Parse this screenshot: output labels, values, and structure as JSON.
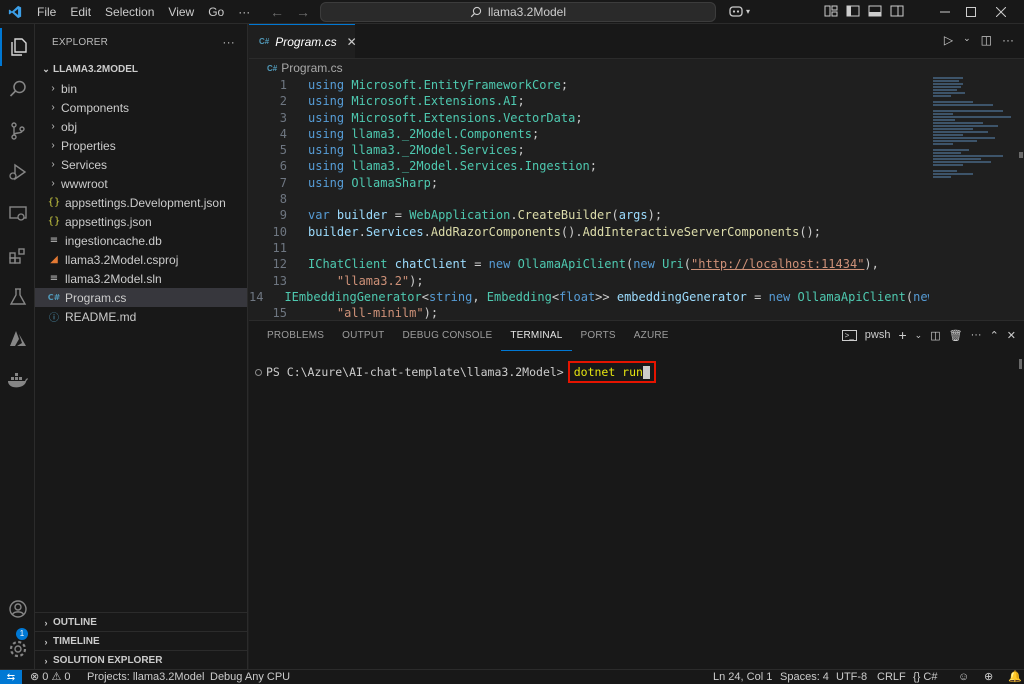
{
  "titlebar": {
    "menu": [
      "File",
      "Edit",
      "Selection",
      "View",
      "Go",
      "···"
    ],
    "search_text": "llama3.2Model"
  },
  "sidebar": {
    "title": "EXPLORER",
    "more": "···",
    "root": "LLAMA3.2MODEL",
    "folders": [
      "bin",
      "Components",
      "obj",
      "Properties",
      "Services",
      "wwwroot"
    ],
    "files": [
      {
        "icon": "{}",
        "name": "appsettings.Development.json",
        "color": "#cbcb41"
      },
      {
        "icon": "{}",
        "name": "appsettings.json",
        "color": "#cbcb41"
      },
      {
        "icon": "≡",
        "name": "ingestioncache.db",
        "color": "#cccccc"
      },
      {
        "icon": "≡",
        "name": "llama3.2Model.csproj",
        "color": "#e37933"
      },
      {
        "icon": "≡",
        "name": "llama3.2Model.sln",
        "color": "#cccccc"
      },
      {
        "icon": "C#",
        "name": "Program.cs",
        "color": "#519aba"
      },
      {
        "icon": "ⓘ",
        "name": "README.md",
        "color": "#519aba"
      }
    ],
    "sections": [
      "OUTLINE",
      "TIMELINE",
      "SOLUTION EXPLORER"
    ]
  },
  "editor": {
    "tab_label": "Program.cs",
    "breadcrumb": "Program.cs",
    "line_numbers": [
      "1",
      "2",
      "3",
      "4",
      "5",
      "6",
      "7",
      "8",
      "9",
      "10",
      "11",
      "12",
      "13",
      "14",
      "15"
    ]
  },
  "panel": {
    "tabs": [
      "PROBLEMS",
      "OUTPUT",
      "DEBUG CONSOLE",
      "TERMINAL",
      "PORTS",
      "AZURE"
    ],
    "active_tab": "TERMINAL",
    "shell": "pwsh",
    "prompt": "PS C:\\Azure\\AI-chat-template\\llama3.2Model>",
    "command": "dotnet run"
  },
  "statusbar": {
    "problems": "⊗ 0 ⚠ 0",
    "project": "Projects: llama3.2Model",
    "debug": "Debug Any CPU",
    "position": "Ln 24, Col 1",
    "spaces": "Spaces: 4",
    "encoding": "UTF-8",
    "eol": "CRLF",
    "language": "{} C#"
  },
  "colors": {
    "accent": "#0078d4",
    "highlight_box": "#e51400"
  }
}
